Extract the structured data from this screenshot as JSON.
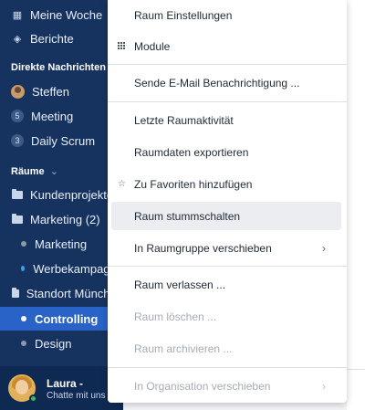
{
  "sidebar": {
    "nav": [
      {
        "label": "Meine Woche",
        "icon": "calendar-icon"
      },
      {
        "label": "Berichte",
        "icon": "layers-icon"
      }
    ],
    "dm_title": "Direkte Nachrichten",
    "dms": [
      {
        "label": "Steffen"
      },
      {
        "label": "Meeting",
        "badge": "5"
      },
      {
        "label": "Daily Scrum",
        "badge": "3"
      }
    ],
    "rooms_title": "Räume",
    "rooms": [
      {
        "label": "Kundenprojekte",
        "kind": "folder"
      },
      {
        "label": "Marketing (2)",
        "kind": "folder"
      },
      {
        "label": "Marketing",
        "kind": "dot",
        "dot_color": "#8c98a8"
      },
      {
        "label": "Werbekampagne",
        "kind": "dot",
        "dot_color": "#3aa0e8"
      },
      {
        "label": "Standort München",
        "kind": "folder"
      },
      {
        "label": "Controlling",
        "kind": "dot",
        "dot_color": "#ffffff",
        "active": true
      },
      {
        "label": "Design",
        "kind": "dot",
        "dot_color": "#8c98a8"
      }
    ],
    "user": {
      "name": "Laura -",
      "status": "Chatte mit uns"
    }
  },
  "menu": {
    "items": [
      {
        "label": "Raum Einstellungen"
      },
      {
        "label": "Module",
        "icon": "grid-icon"
      },
      {
        "label": "Sende E-Mail Benachrichtigung ..."
      },
      {
        "label": "Letzte Raumaktivität"
      },
      {
        "label": "Raumdaten exportieren"
      },
      {
        "label": "Zu Favoriten hinzufügen",
        "icon": "star-icon"
      },
      {
        "label": "Raum stummschalten",
        "hovered": true
      },
      {
        "label": "In Raumgruppe verschieben",
        "submenu": true
      },
      {
        "label": "Raum verlassen ..."
      },
      {
        "label": "Raum löschen ...",
        "disabled": true
      },
      {
        "label": "Raum archivieren ...",
        "disabled": true
      },
      {
        "label": "In Organisation verschieben",
        "submenu": true,
        "disabled": true
      }
    ]
  },
  "colors": {
    "sidebar": "#16335f",
    "active": "#2a63c7",
    "online": "#46b65a"
  }
}
